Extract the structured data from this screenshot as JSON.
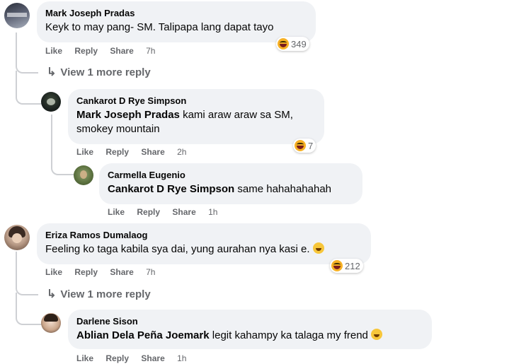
{
  "comments": [
    {
      "name": "Mark Joseph Pradas",
      "text": "Keyk to may pang- SM. Talipapa lang dapat tayo",
      "actions": {
        "like": "Like",
        "reply": "Reply",
        "share": "Share",
        "time": "7h"
      },
      "reaction_count": "349",
      "more_replies": "View 1 more reply"
    },
    {
      "name": "Cankarot D Rye Simpson",
      "mention": "Mark Joseph Pradas",
      "text_line1": "kami araw araw sa SM,",
      "text_line2": "smokey mountain",
      "actions": {
        "like": "Like",
        "reply": "Reply",
        "share": "Share",
        "time": "2h"
      },
      "reaction_count": "7"
    },
    {
      "name": "Carmella Eugenio",
      "mention": "Cankarot D Rye Simpson",
      "text": "same hahahahahah",
      "actions": {
        "like": "Like",
        "reply": "Reply",
        "share": "Share",
        "time": "1h"
      }
    },
    {
      "name": "Eriza Ramos Dumalaog",
      "text": "Feeling ko taga kabila sya dai, yung aurahan nya kasi e.",
      "actions": {
        "like": "Like",
        "reply": "Reply",
        "share": "Share",
        "time": "7h"
      },
      "reaction_count": "212",
      "more_replies": "View 1 more reply"
    },
    {
      "name": "Darlene Sison",
      "mention": "Ablian Dela Peña Joemark",
      "text": "legit kahampy ka talaga my frend",
      "actions": {
        "like": "Like",
        "reply": "Reply",
        "share": "Share",
        "time": "1h"
      }
    }
  ],
  "colors": {
    "bubble": "#f0f2f5",
    "meta": "#65676b",
    "thread_line": "#ced0d4",
    "haha": "#f7b125"
  }
}
